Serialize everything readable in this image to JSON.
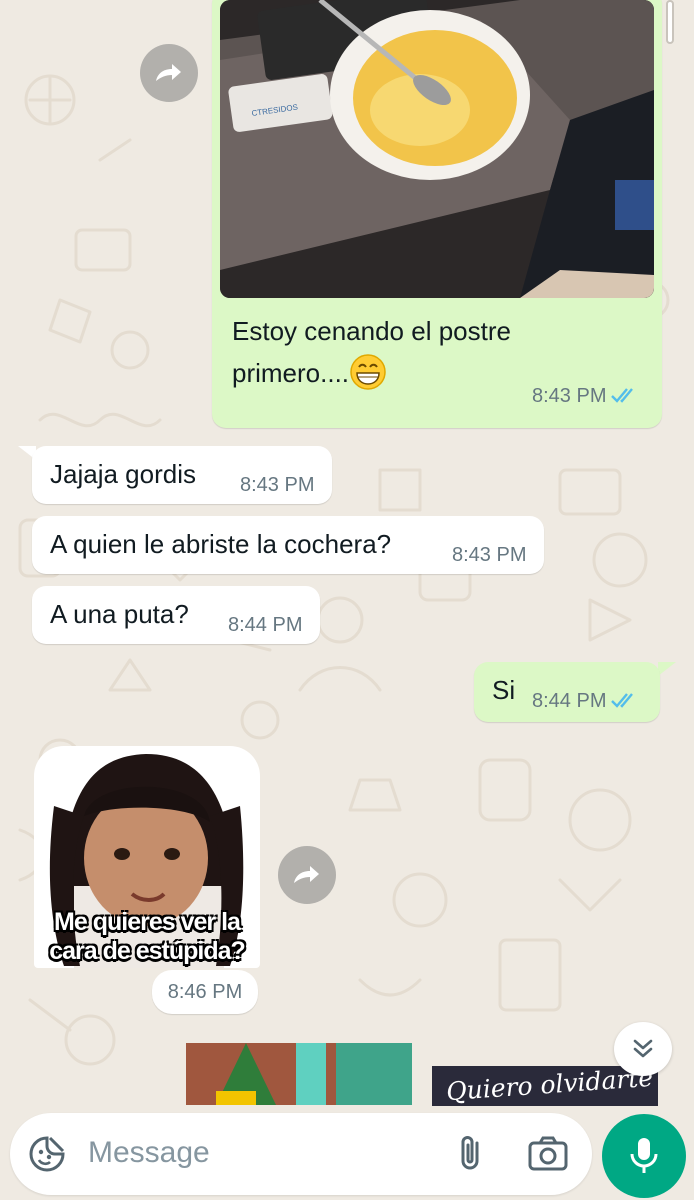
{
  "messages": [
    {
      "id": "m1",
      "direction": "out",
      "type": "image",
      "caption": "Estoy cenando el postre primero....",
      "caption_emoji": "grinning-face",
      "time": "8:43 PM",
      "status": "read"
    },
    {
      "id": "m2",
      "direction": "in",
      "text": "Jajaja gordis",
      "time": "8:43 PM"
    },
    {
      "id": "m3",
      "direction": "in",
      "text": "A quien le abriste la cochera?",
      "time": "8:43 PM"
    },
    {
      "id": "m4",
      "direction": "in",
      "text": "A una puta?",
      "time": "8:44 PM"
    },
    {
      "id": "m5",
      "direction": "out",
      "text": "Si",
      "time": "8:44 PM",
      "status": "read"
    },
    {
      "id": "m6",
      "direction": "in",
      "type": "sticker",
      "sticker_text": "Me quieres ver la cara de estúpida?",
      "time": "8:46 PM"
    },
    {
      "id": "m7",
      "direction": "in",
      "type": "image-partial",
      "text": ""
    },
    {
      "id": "m8",
      "direction": "in",
      "type": "image-partial",
      "overlay_text": "Quiero olvidarte"
    }
  ],
  "photo": {
    "name_tag_text": "CTRESIDOS"
  },
  "composer": {
    "placeholder": "Message"
  },
  "icons": {
    "forward": "forward-icon",
    "scroll_down": "double-chevron-down-icon",
    "emoji": "sticker-smiley-icon",
    "attach": "paperclip-icon",
    "camera": "camera-icon",
    "mic": "microphone-icon",
    "read_ticks": "double-check-icon"
  },
  "colors": {
    "background": "#efeae2",
    "outgoing_bubble": "#dcf8c6",
    "incoming_bubble": "#ffffff",
    "meta_text": "#667781",
    "read_ticks": "#53bdeb",
    "mic_button": "#00a884"
  }
}
